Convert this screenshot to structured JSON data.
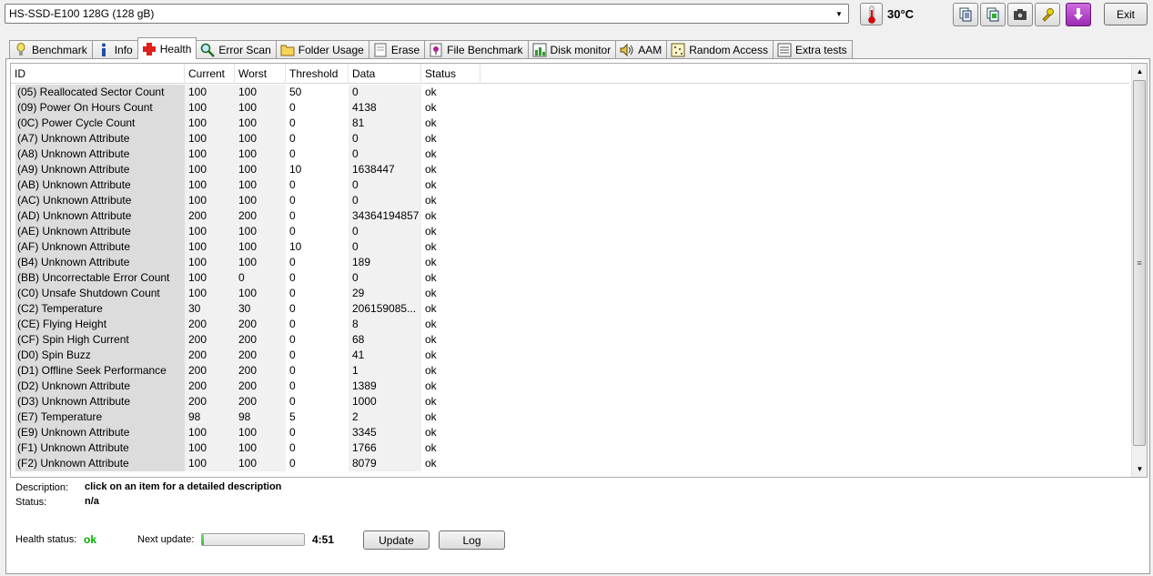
{
  "drive": {
    "selected": "HS-SSD-E100 128G (128 gB)"
  },
  "temperature": {
    "value": "30°C"
  },
  "toolbar": {
    "exit_label": "Exit",
    "buttons": [
      "copy-text-icon",
      "copy-image-icon",
      "screenshot-icon",
      "options-icon",
      "save-icon"
    ]
  },
  "tabs": [
    {
      "label": "Benchmark",
      "icon": "benchmark-icon"
    },
    {
      "label": "Info",
      "icon": "info-icon"
    },
    {
      "label": "Health",
      "icon": "health-icon",
      "active": true
    },
    {
      "label": "Error Scan",
      "icon": "error-scan-icon"
    },
    {
      "label": "Folder Usage",
      "icon": "folder-icon"
    },
    {
      "label": "Erase",
      "icon": "erase-icon"
    },
    {
      "label": "File Benchmark",
      "icon": "file-benchmark-icon"
    },
    {
      "label": "Disk monitor",
      "icon": "disk-monitor-icon"
    },
    {
      "label": "AAM",
      "icon": "speaker-icon"
    },
    {
      "label": "Random Access",
      "icon": "random-access-icon"
    },
    {
      "label": "Extra tests",
      "icon": "extra-tests-icon"
    }
  ],
  "table": {
    "headers": {
      "id": "ID",
      "current": "Current",
      "worst": "Worst",
      "threshold": "Threshold",
      "data": "Data",
      "status": "Status"
    },
    "rows": [
      {
        "id": "(05) Reallocated Sector Count",
        "current": "100",
        "worst": "100",
        "threshold": "50",
        "data": "0",
        "status": "ok"
      },
      {
        "id": "(09) Power On Hours Count",
        "current": "100",
        "worst": "100",
        "threshold": "0",
        "data": "4138",
        "status": "ok"
      },
      {
        "id": "(0C) Power Cycle Count",
        "current": "100",
        "worst": "100",
        "threshold": "0",
        "data": "81",
        "status": "ok"
      },
      {
        "id": "(A7) Unknown Attribute",
        "current": "100",
        "worst": "100",
        "threshold": "0",
        "data": "0",
        "status": "ok"
      },
      {
        "id": "(A8) Unknown Attribute",
        "current": "100",
        "worst": "100",
        "threshold": "0",
        "data": "0",
        "status": "ok"
      },
      {
        "id": "(A9) Unknown Attribute",
        "current": "100",
        "worst": "100",
        "threshold": "10",
        "data": "1638447",
        "status": "ok"
      },
      {
        "id": "(AB) Unknown Attribute",
        "current": "100",
        "worst": "100",
        "threshold": "0",
        "data": "0",
        "status": "ok"
      },
      {
        "id": "(AC) Unknown Attribute",
        "current": "100",
        "worst": "100",
        "threshold": "0",
        "data": "0",
        "status": "ok"
      },
      {
        "id": "(AD) Unknown Attribute",
        "current": "200",
        "worst": "200",
        "threshold": "0",
        "data": "34364194857",
        "status": "ok"
      },
      {
        "id": "(AE) Unknown Attribute",
        "current": "100",
        "worst": "100",
        "threshold": "0",
        "data": "0",
        "status": "ok"
      },
      {
        "id": "(AF) Unknown Attribute",
        "current": "100",
        "worst": "100",
        "threshold": "10",
        "data": "0",
        "status": "ok"
      },
      {
        "id": "(B4) Unknown Attribute",
        "current": "100",
        "worst": "100",
        "threshold": "0",
        "data": "189",
        "status": "ok"
      },
      {
        "id": "(BB) Uncorrectable Error Count",
        "current": "100",
        "worst": "0",
        "threshold": "0",
        "data": "0",
        "status": "ok"
      },
      {
        "id": "(C0) Unsafe Shutdown Count",
        "current": "100",
        "worst": "100",
        "threshold": "0",
        "data": "29",
        "status": "ok"
      },
      {
        "id": "(C2) Temperature",
        "current": "30",
        "worst": "30",
        "threshold": "0",
        "data": "206159085...",
        "status": "ok"
      },
      {
        "id": "(CE) Flying Height",
        "current": "200",
        "worst": "200",
        "threshold": "0",
        "data": "8",
        "status": "ok"
      },
      {
        "id": "(CF) Spin High Current",
        "current": "200",
        "worst": "200",
        "threshold": "0",
        "data": "68",
        "status": "ok"
      },
      {
        "id": "(D0) Spin Buzz",
        "current": "200",
        "worst": "200",
        "threshold": "0",
        "data": "41",
        "status": "ok"
      },
      {
        "id": "(D1) Offline Seek Performance",
        "current": "200",
        "worst": "200",
        "threshold": "0",
        "data": "1",
        "status": "ok"
      },
      {
        "id": "(D2) Unknown Attribute",
        "current": "200",
        "worst": "200",
        "threshold": "0",
        "data": "1389",
        "status": "ok"
      },
      {
        "id": "(D3) Unknown Attribute",
        "current": "200",
        "worst": "200",
        "threshold": "0",
        "data": "1000",
        "status": "ok"
      },
      {
        "id": "(E7) Temperature",
        "current": "98",
        "worst": "98",
        "threshold": "5",
        "data": "2",
        "status": "ok"
      },
      {
        "id": "(E9) Unknown Attribute",
        "current": "100",
        "worst": "100",
        "threshold": "0",
        "data": "3345",
        "status": "ok"
      },
      {
        "id": "(F1) Unknown Attribute",
        "current": "100",
        "worst": "100",
        "threshold": "0",
        "data": "1766",
        "status": "ok"
      },
      {
        "id": "(F2) Unknown Attribute",
        "current": "100",
        "worst": "100",
        "threshold": "0",
        "data": "8079",
        "status": "ok"
      }
    ]
  },
  "details": {
    "description_label": "Description:",
    "description_value": "click on an item for a detailed description",
    "status_label": "Status:",
    "status_value": "n/a"
  },
  "health": {
    "label": "Health status:",
    "value": "ok",
    "next_update_label": "Next update:",
    "next_update_progress": 0.02,
    "countdown": "4:51",
    "update_label": "Update",
    "log_label": "Log"
  }
}
